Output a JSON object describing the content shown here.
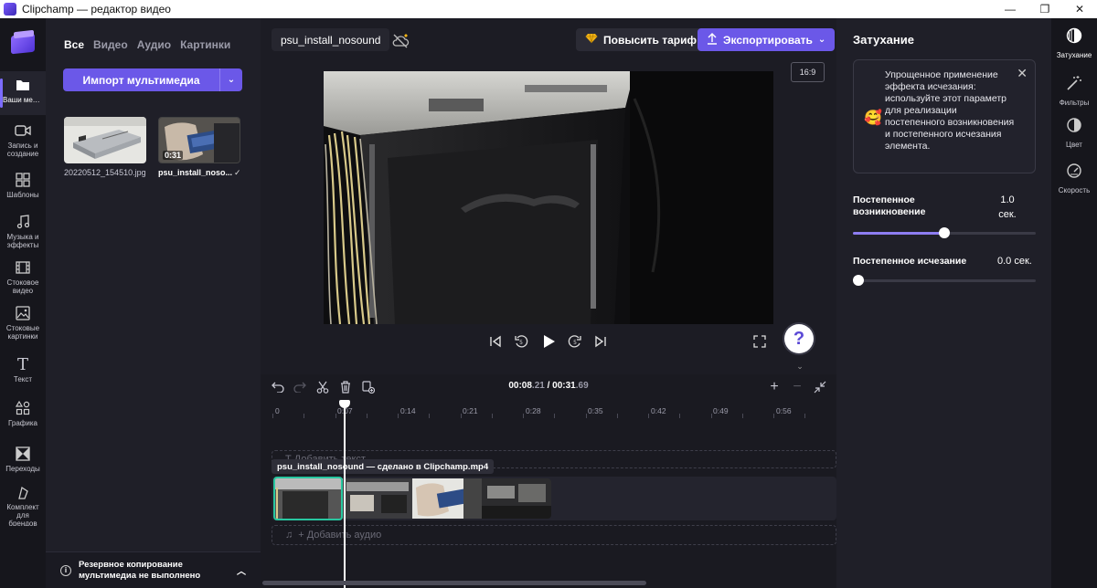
{
  "window": {
    "title": "Clipchamp — редактор видео",
    "minimize": "—",
    "maximize": "❐",
    "close": "✕"
  },
  "left_rail": {
    "items": [
      {
        "label": "Ваши медиаресурсы",
        "icon": "folder-icon"
      },
      {
        "label": "Запись и создание",
        "icon": "camera-icon"
      },
      {
        "label": "Шаблоны",
        "icon": "templates-icon"
      },
      {
        "label": "Музыка и эффекты",
        "icon": "music-icon"
      },
      {
        "label": "Стоковое видео",
        "icon": "film-icon"
      },
      {
        "label": "Стоковые картинки",
        "icon": "image-icon"
      },
      {
        "label": "Текст",
        "icon": "text-icon"
      },
      {
        "label": "Графика",
        "icon": "shapes-icon"
      },
      {
        "label": "Переходы",
        "icon": "transitions-icon"
      },
      {
        "label": "Комплект для брендов",
        "icon": "brand-kit-icon"
      }
    ]
  },
  "media_panel": {
    "tabs": [
      "Все",
      "Видео",
      "Аудио",
      "Картинки"
    ],
    "active_tab": "Все",
    "import_label": "Импорт мультимедиа",
    "items": [
      {
        "name": "20220512_154510.jpg",
        "duration": ""
      },
      {
        "name": "psu_install_noso...",
        "duration": "0:31",
        "used": "✓"
      }
    ],
    "backup_text": "Резервное копирование мультимедиа не выполнено"
  },
  "header": {
    "project_name": "psu_install_nosound",
    "upgrade_label": "Повысить тариф",
    "export_label": "Экспортировать"
  },
  "preview": {
    "aspect_ratio": "16:9",
    "help": "?"
  },
  "timeline": {
    "time_current": "00:08",
    "time_current_frac": ".21",
    "time_sep": " / ",
    "time_total": "00:31",
    "time_total_frac": ".69",
    "ruler_labels": [
      "0",
      "0:07",
      "0:14",
      "0:21",
      "0:28",
      "0:35",
      "0:42",
      "0:49",
      "0:56"
    ],
    "text_track_placeholder": "Т  Добавить текст",
    "clip_tooltip": "psu_install_nosound — сделано в Clipchamp.mp4",
    "audio_track_placeholder": "+ Добавить аудио"
  },
  "properties": {
    "title": "Затухание",
    "tip": "Упрощенное применение эффекта исчезания: используйте этот параметр для реализации постепенного возникновения и постепенного исчезания элемента.",
    "fade_in": {
      "label": "Постепенное возникновение",
      "value": "1.0",
      "unit": "сек.",
      "fraction": 0.5
    },
    "fade_out": {
      "label": "Постепенное исчезание",
      "value": "0.0 сек.",
      "fraction": 0.0
    }
  },
  "right_rail": {
    "items": [
      {
        "label": "Затухание",
        "icon": "fade-icon"
      },
      {
        "label": "Фильтры",
        "icon": "magic-wand-icon"
      },
      {
        "label": "Цвет",
        "icon": "color-icon"
      },
      {
        "label": "Скорость",
        "icon": "speedometer-icon"
      }
    ]
  },
  "colors": {
    "accent": "#6b58e8",
    "selection": "#28c7a0",
    "panel": "#1f1f28",
    "rail": "#16161c"
  }
}
